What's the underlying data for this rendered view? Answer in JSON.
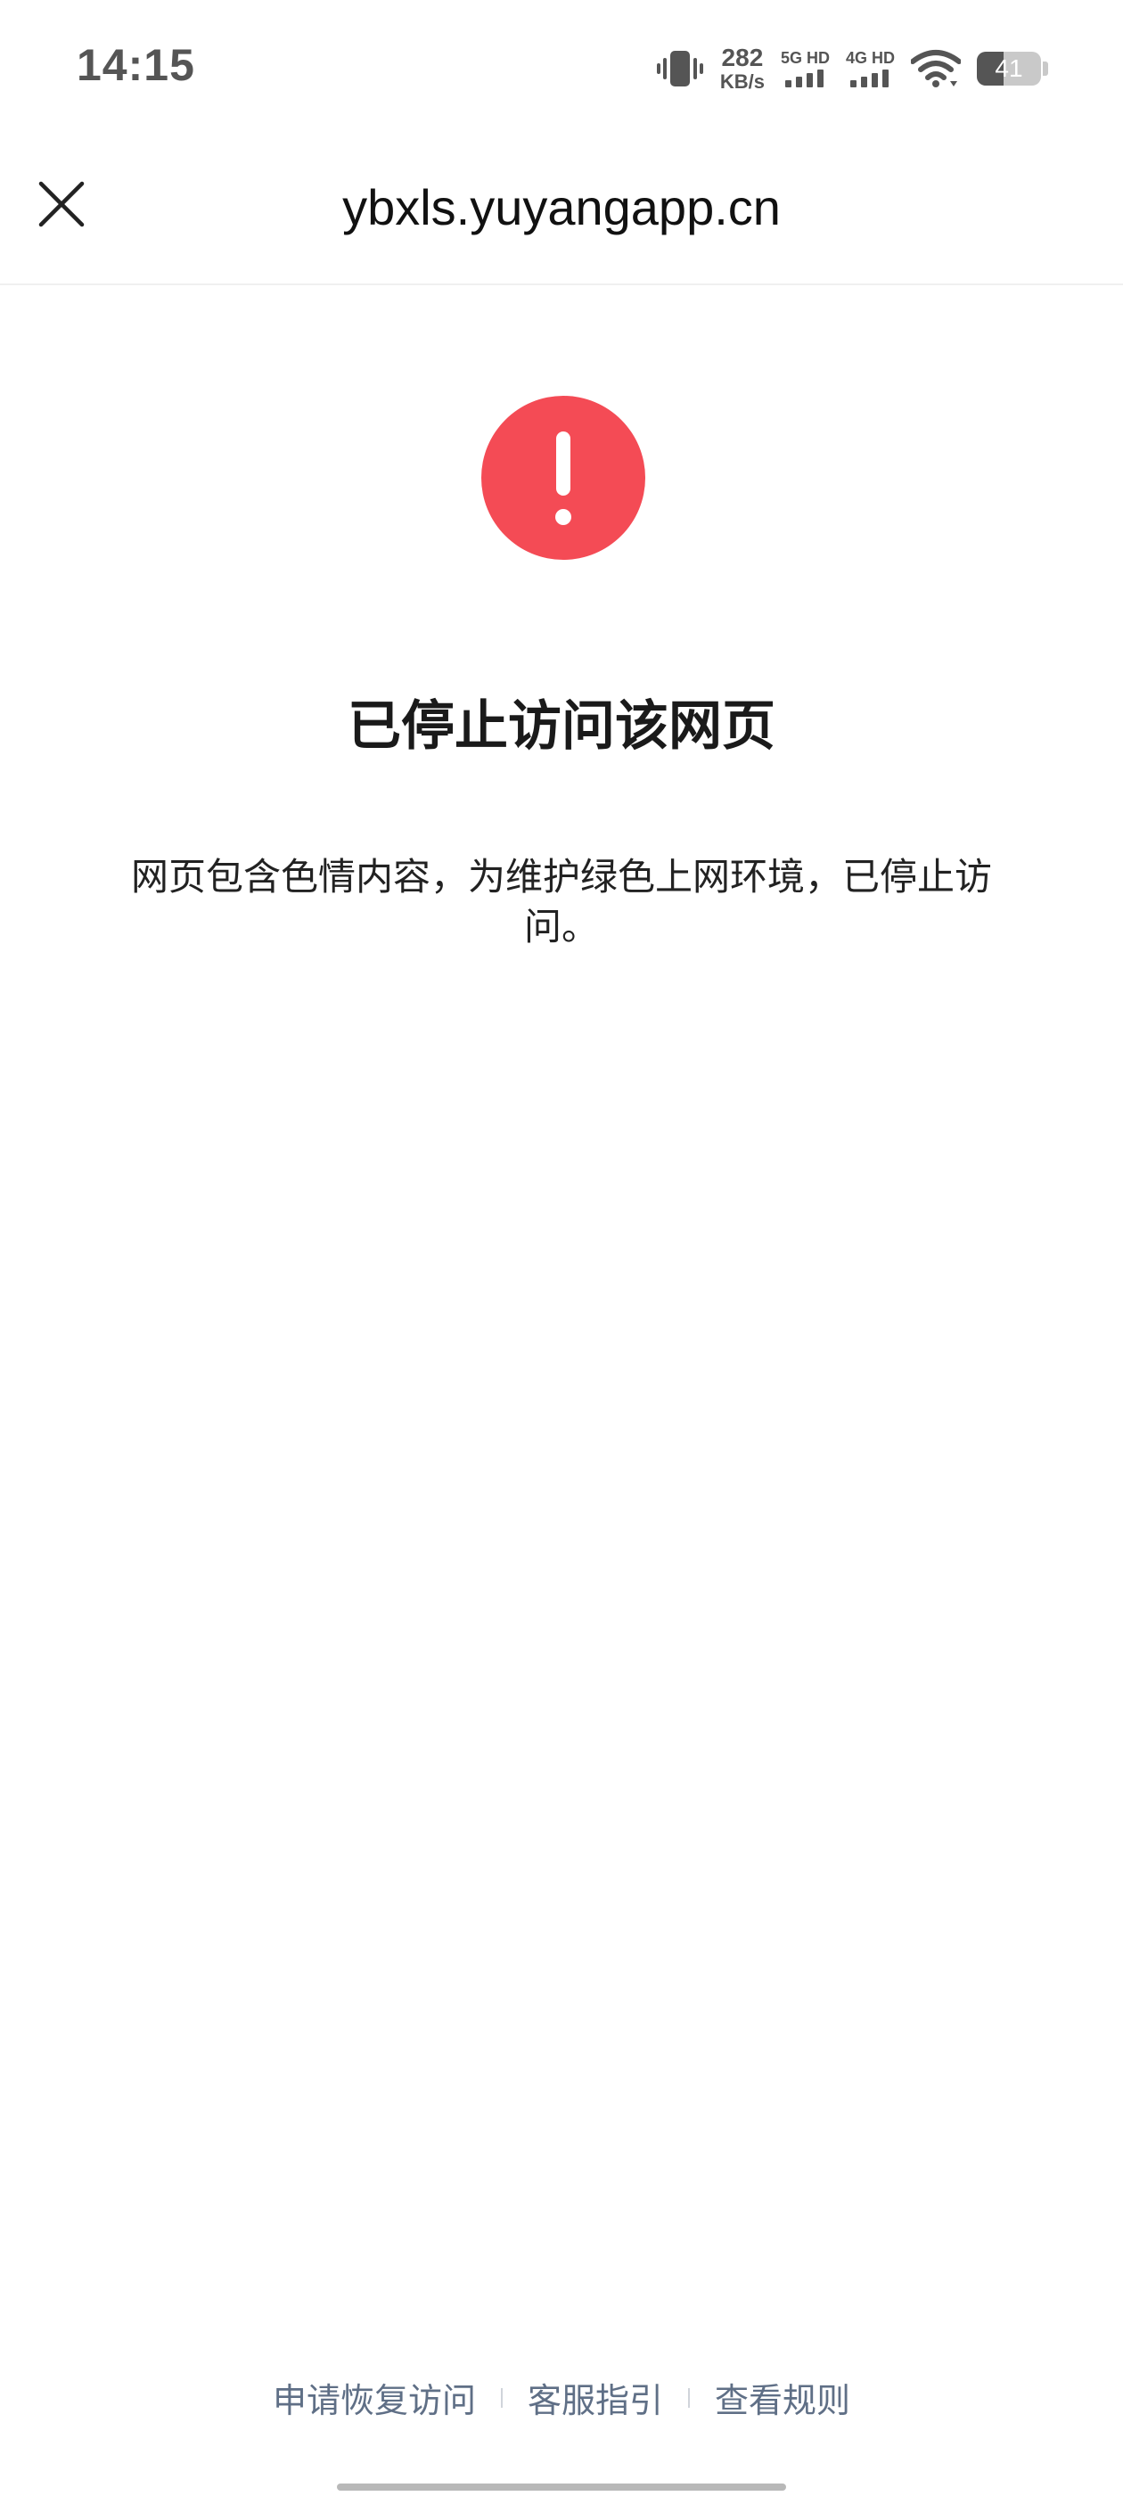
{
  "status_bar": {
    "time": "14:15",
    "net_speed_value": "282",
    "net_speed_unit": "KB/s",
    "sim1_label": "5G HD",
    "sim2_label": "4G HD",
    "battery_level": "41",
    "battery_fraction": 0.41
  },
  "header": {
    "url": "ybxls.yuyangapp.cn",
    "close_icon": "close-icon"
  },
  "main": {
    "icon": "warning-icon",
    "icon_color": "#f44b55",
    "title": "已停止访问该网页",
    "message": "网页包含色情内容，为维护绿色上网环境，已停止访问。"
  },
  "footer": {
    "links": [
      "申请恢复访问",
      "客服指引",
      "查看规则"
    ],
    "link_color": "#5f6f86"
  }
}
